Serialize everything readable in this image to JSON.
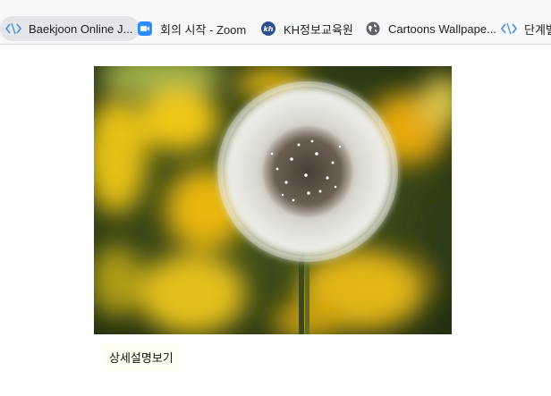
{
  "bookmarks": [
    {
      "label": "Baekjoon Online J...",
      "icon": "code-bracket-icon"
    },
    {
      "label": "회의 시작 - Zoom",
      "icon": "zoom-camera-icon"
    },
    {
      "label": "KH정보교육원",
      "icon": "kh-logo-icon"
    },
    {
      "label": "Cartoons Wallpape...",
      "icon": "globe-icon"
    },
    {
      "label": "단계별",
      "icon": "code-bracket-icon"
    }
  ],
  "image": {
    "subject": "dandelion seed head"
  },
  "detail_button": {
    "label": "상세설명보기"
  },
  "colors": {
    "accent_blue": "#4a8fd9",
    "zoom_blue": "#2d8cff"
  }
}
